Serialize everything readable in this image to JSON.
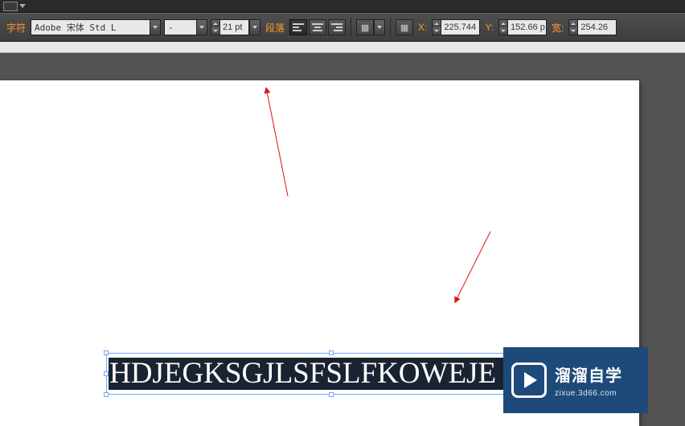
{
  "toolbar": {
    "char_label": "字符",
    "font_family": "Adobe 宋体 Std L",
    "font_style": "-",
    "font_size": "21 pt",
    "para_label": "段落",
    "x_label": "X:",
    "x_value": "225.744",
    "y_label": "Y:",
    "y_value": "152.66 p",
    "w_label": "宽:",
    "w_value": "254.26"
  },
  "canvas": {
    "text": "HDJEGKSGJLSFSLFKOWEJE"
  },
  "watermark": {
    "title": "溜溜自学",
    "url": "zixue.3d66.com"
  }
}
